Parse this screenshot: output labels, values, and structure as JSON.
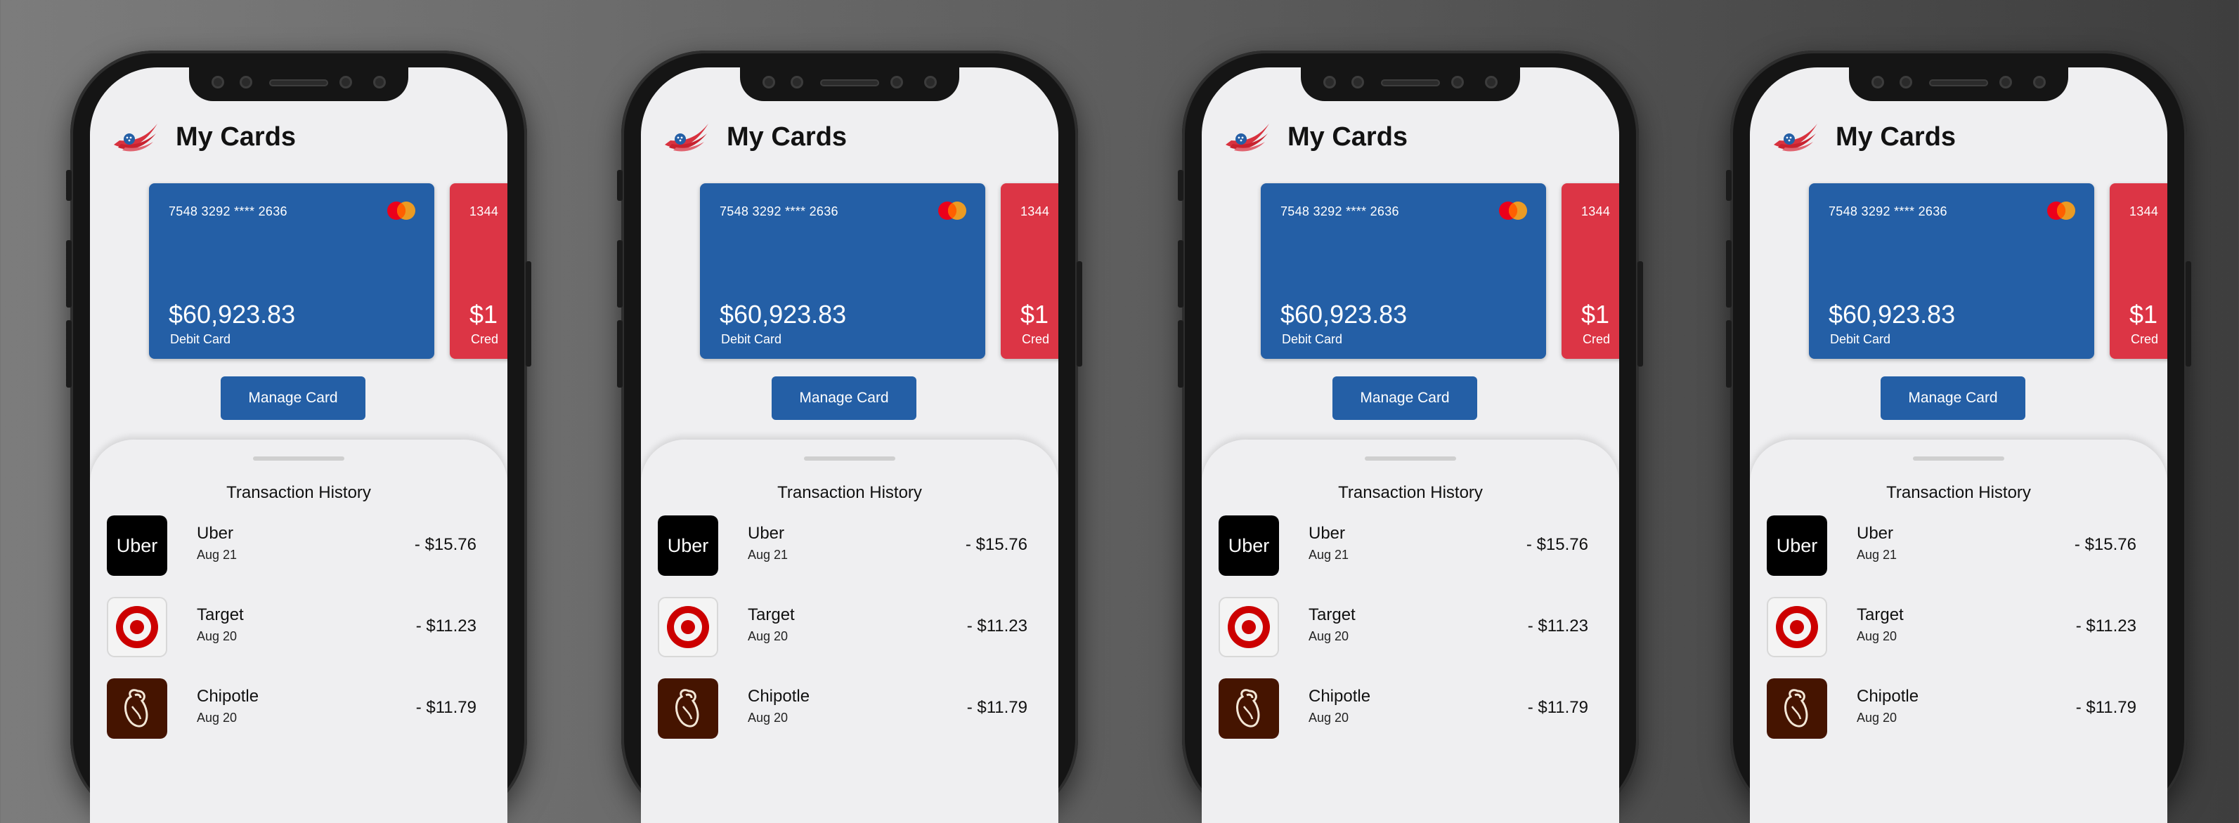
{
  "app": {
    "title": "My Cards"
  },
  "cards": [
    {
      "number": "7548 3292 **** 2636",
      "balance": "$60,923.83",
      "type": "Debit Card",
      "color": "#245fa6"
    },
    {
      "number": "1344",
      "balance": "$1",
      "type": "Cred",
      "color": "#dc3545"
    }
  ],
  "manage_button": {
    "label": "Manage Card"
  },
  "transactions": {
    "title": "Transaction History",
    "items": [
      {
        "merchant": "Uber",
        "date": "Aug 21",
        "amount": "- $15.76",
        "icon": "uber-logo-icon"
      },
      {
        "merchant": "Target",
        "date": "Aug 20",
        "amount": "- $11.23",
        "icon": "target-logo-icon"
      },
      {
        "merchant": "Chipotle",
        "date": "Aug 20",
        "amount": "- $11.79",
        "icon": "chipotle-logo-icon"
      }
    ]
  },
  "uber_icon_text": "Uber",
  "colors": {
    "accent": "#245fa6",
    "credit": "#dc3545",
    "screen_bg": "#efeff1"
  }
}
